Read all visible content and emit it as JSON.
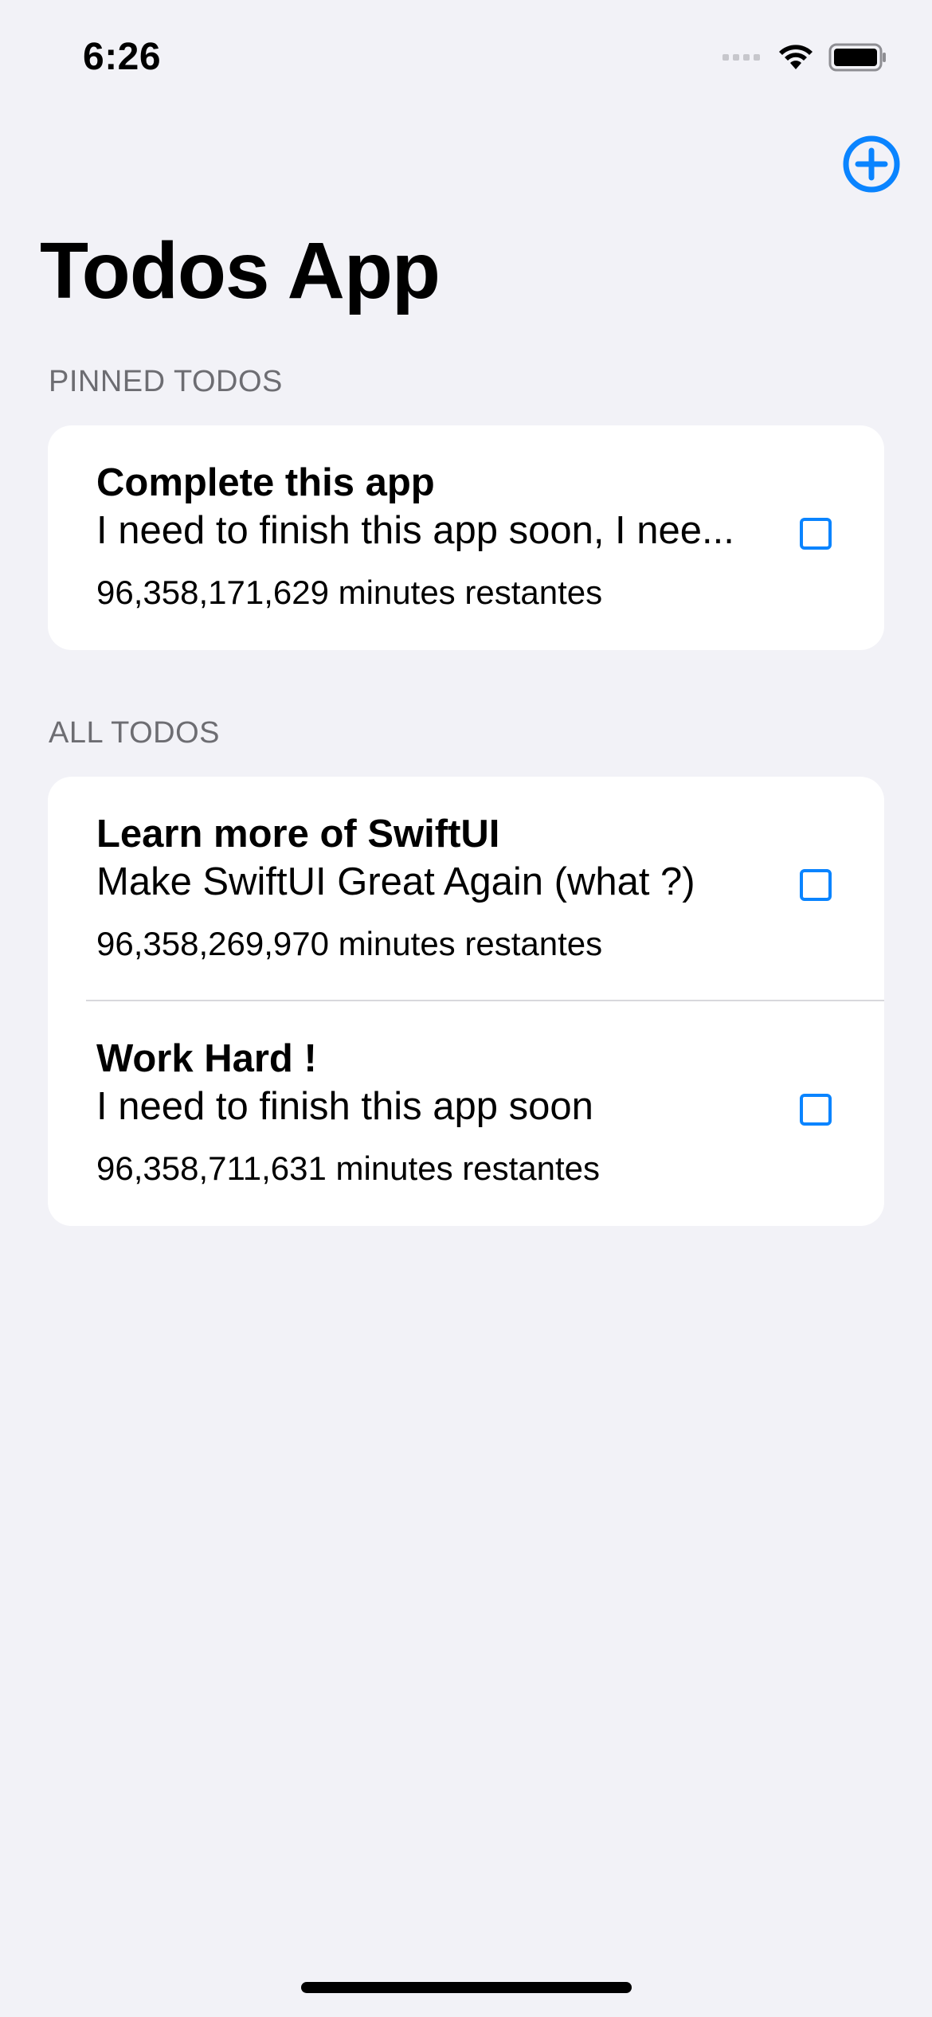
{
  "status_bar": {
    "time": "6:26"
  },
  "nav": {
    "add_icon": "plus-circle-icon",
    "title": "Todos App"
  },
  "sections": [
    {
      "header": "PINNED TODOS",
      "items": [
        {
          "title": "Complete this app",
          "description": "I need to finish this app soon, I nee...",
          "time_left": "96,358,171,629 minutes restantes",
          "checked": false
        }
      ]
    },
    {
      "header": "ALL TODOS",
      "items": [
        {
          "title": "Learn more of SwiftUI",
          "description": "Make SwiftUI Great Again (what ?)",
          "time_left": "96,358,269,970 minutes restantes",
          "checked": false
        },
        {
          "title": "Work Hard !",
          "description": "I need to finish this app soon",
          "time_left": "96,358,711,631 minutes restantes",
          "checked": false
        }
      ]
    }
  ],
  "colors": {
    "accent": "#0A84FF",
    "background": "#F2F2F7",
    "card": "#FFFFFF",
    "secondary_text": "#6D6D72"
  }
}
